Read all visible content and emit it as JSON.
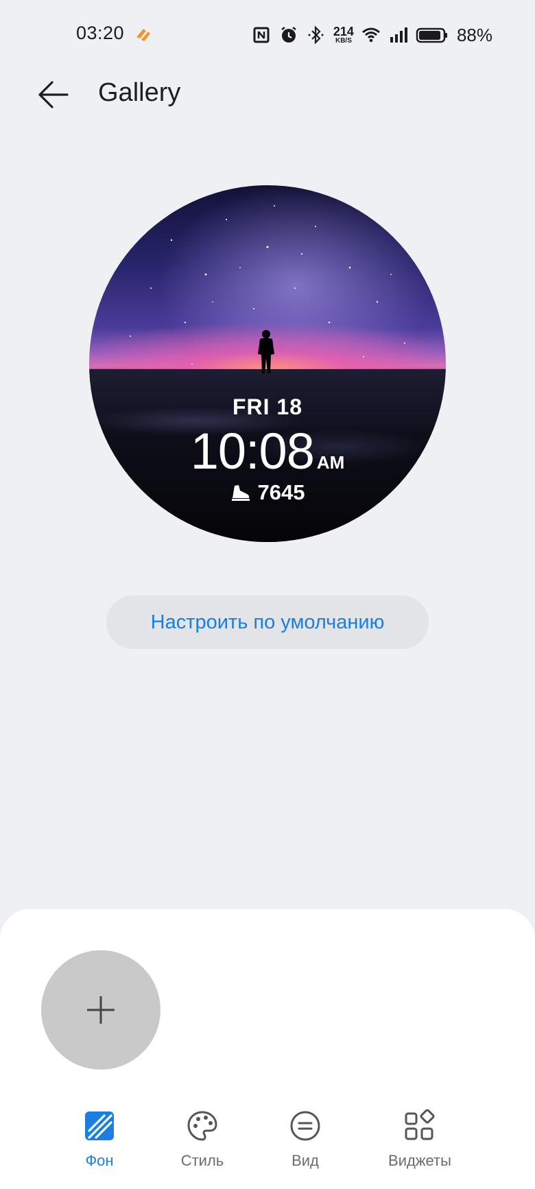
{
  "status_bar": {
    "time": "03:20",
    "net_speed_value": "214",
    "net_speed_unit": "KB/S",
    "battery_percent": "88%",
    "icons": [
      "app-notification-icon",
      "nfc-icon",
      "alarm-icon",
      "bluetooth-icon",
      "wifi-icon",
      "signal-icon",
      "battery-icon"
    ]
  },
  "header": {
    "back_icon": "back-arrow-icon",
    "title": "Gallery"
  },
  "watch_face": {
    "date": "FRI 18",
    "time": "10:08",
    "ampm": "AM",
    "steps": "7645",
    "steps_icon": "shoe-icon"
  },
  "reset_button": {
    "label": "Настроить по умолчанию"
  },
  "bottom_sheet": {
    "add_icon": "plus-icon",
    "tabs": [
      {
        "label": "Фон",
        "icon": "background-icon",
        "active": true
      },
      {
        "label": "Стиль",
        "icon": "palette-icon",
        "active": false
      },
      {
        "label": "Вид",
        "icon": "layout-icon",
        "active": false
      },
      {
        "label": "Виджеты",
        "icon": "widgets-icon",
        "active": false
      }
    ]
  },
  "colors": {
    "accent": "#1a7fe0",
    "background": "#eef0f4",
    "sheet": "#ffffff",
    "add_button": "#c9c9c9",
    "app_icon": "#f5922a"
  }
}
